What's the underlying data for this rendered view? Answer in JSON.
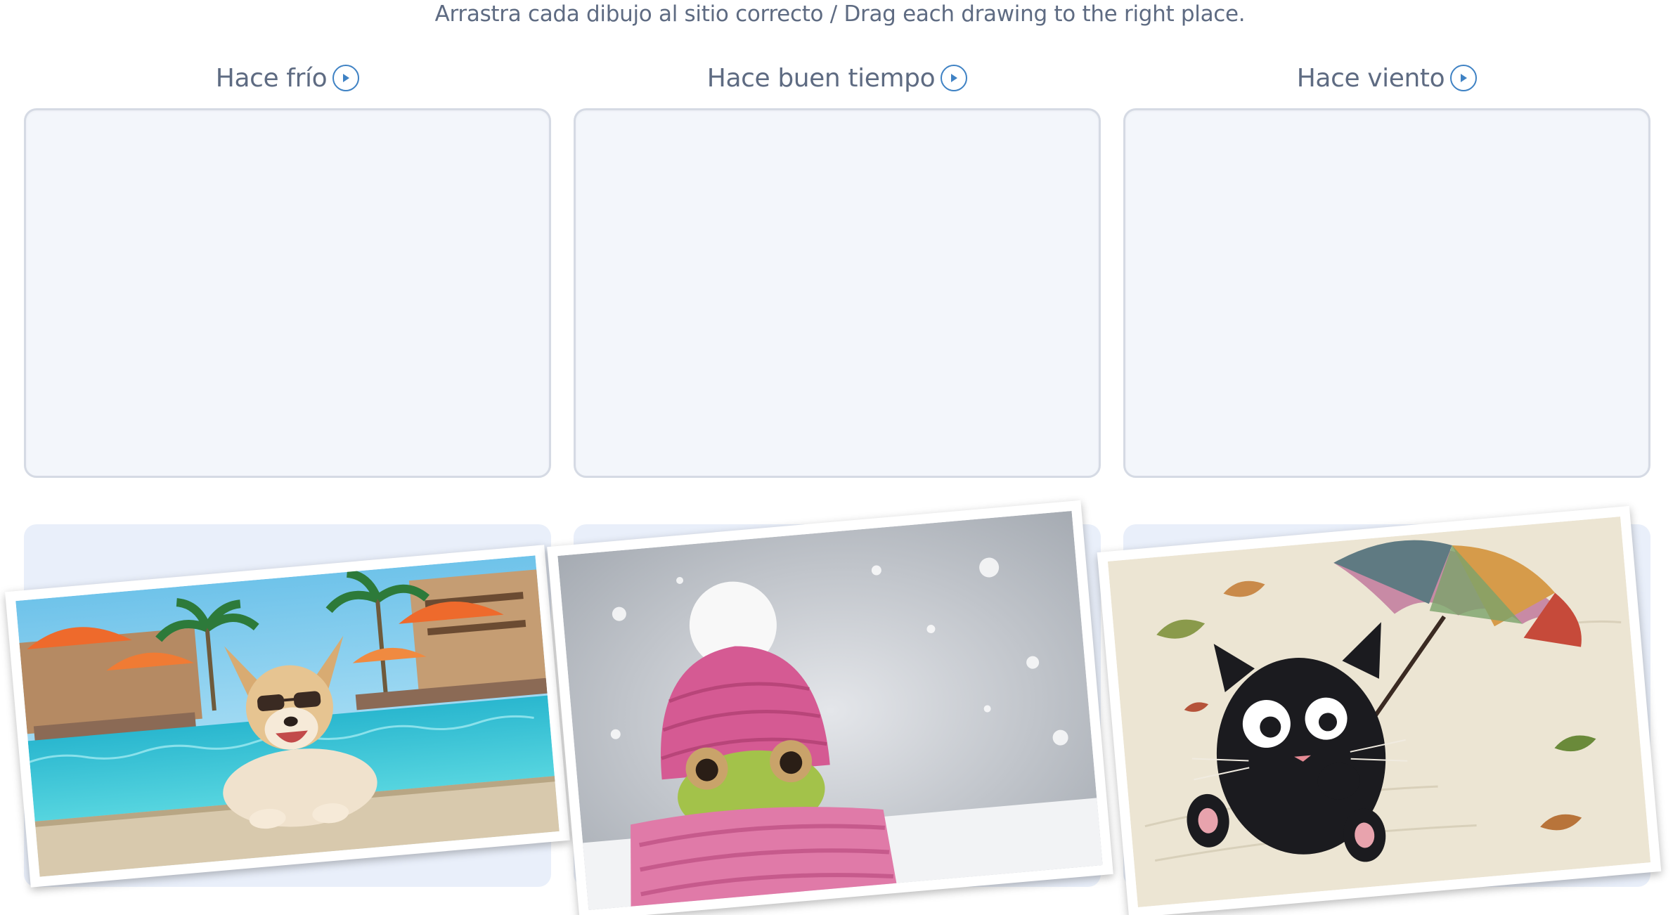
{
  "instruction": "Arrastra cada dibujo al sitio correcto / Drag each drawing to the right place.",
  "categories": [
    {
      "label": "Hace frío"
    },
    {
      "label": "Hace buen tiempo"
    },
    {
      "label": "Hace viento"
    }
  ],
  "cards": [
    {
      "subject": "dog with sunglasses lying by a swimming pool",
      "icon": "sunny-pool-dog-picture"
    },
    {
      "subject": "frog wearing a pink knitted hat and scarf in the snow",
      "icon": "snow-frog-picture"
    },
    {
      "subject": "black cat blown by the wind holding an umbrella",
      "icon": "windy-cat-umbrella-picture"
    }
  ],
  "colors": {
    "text": "#5e6b82",
    "accent": "#3f82c4",
    "drop_zone_bg": "#f3f6fb",
    "drop_zone_border": "#d5dae4",
    "tray_bg": "#e9effa"
  }
}
